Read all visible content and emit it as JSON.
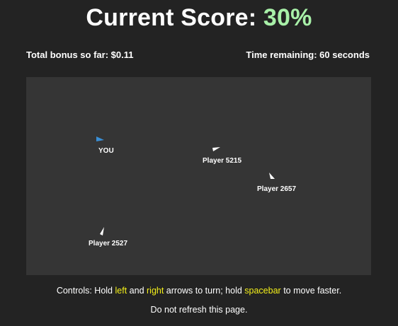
{
  "header": {
    "score_label": "Current Score: ",
    "score_value": "30%",
    "score_color": "#a8f0a8"
  },
  "status": {
    "bonus_text": "Total bonus so far: $0.11",
    "time_text": "Time remaining: 60 seconds"
  },
  "arena": {
    "background": "#353535",
    "players": [
      {
        "name": "YOU",
        "color": "#3a8fd6",
        "is_self": true
      },
      {
        "name": "Player 5215",
        "color": "#ffffff",
        "is_self": false
      },
      {
        "name": "Player 2657",
        "color": "#ffffff",
        "is_self": false
      },
      {
        "name": "Player 2527",
        "color": "#ffffff",
        "is_self": false
      }
    ]
  },
  "controls": {
    "prefix": "Controls: Hold ",
    "left": "left",
    "and": " and ",
    "right": "right",
    "mid": " arrows to turn; hold ",
    "spacebar": "spacebar",
    "suffix": " to move faster.",
    "highlight_color": "#f4f01a"
  },
  "footer": {
    "note": "Do not refresh this page."
  }
}
